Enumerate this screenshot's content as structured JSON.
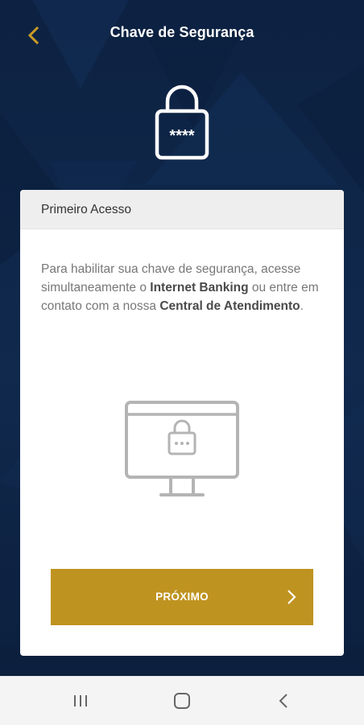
{
  "header": {
    "title": "Chave de Segurança",
    "back_icon": "chevron-left-icon",
    "accent_color": "#c99a26"
  },
  "hero": {
    "icon": "lock-icon",
    "masked_text": "****"
  },
  "card": {
    "header_title": "Primeiro Acesso",
    "message": {
      "part1": "Para habilitar sua chave de segurança, acesse simultaneamente o ",
      "bold1": "Internet Banking",
      "part2": " ou entre em contato com a nossa ",
      "bold2": "Central de Atendimento",
      "part3": "."
    },
    "illustration_icon": "monitor-lock-icon",
    "next_button": {
      "label": "PRÓXIMO",
      "icon": "chevron-right-icon",
      "color": "#bf9320"
    }
  },
  "navbar": {
    "recents_icon": "recents-icon",
    "home_icon": "home-icon",
    "back_icon": "back-icon"
  }
}
